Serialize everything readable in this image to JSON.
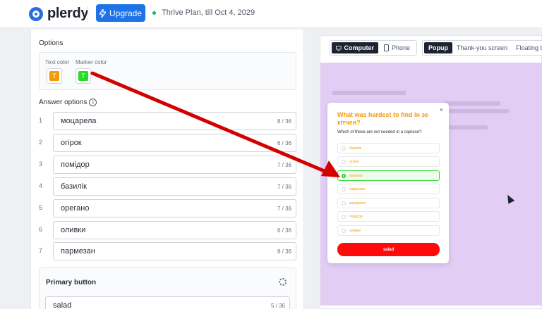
{
  "topbar": {
    "logo_text": "plerdy",
    "upgrade_label": "Upgrade",
    "plan_text": "Thrive Plan, till Oct 4, 2029"
  },
  "options": {
    "title": "Options",
    "text_color_label": "Text color",
    "marker_color_label": "Marker color",
    "text_color": "#f39a0a",
    "marker_color": "#22dd22",
    "swatch_glyph": "T"
  },
  "answers": {
    "title": "Answer options",
    "items": [
      {
        "num": "1",
        "text": "моцарела",
        "count": "8 / 36"
      },
      {
        "num": "2",
        "text": "огірок",
        "count": "6 / 36"
      },
      {
        "num": "3",
        "text": "помідор",
        "count": "7 / 36"
      },
      {
        "num": "4",
        "text": "базилік",
        "count": "7 / 36"
      },
      {
        "num": "5",
        "text": "орегано",
        "count": "7 / 36"
      },
      {
        "num": "6",
        "text": "оливки",
        "count": "6 / 36"
      },
      {
        "num": "7",
        "text": "пармезан",
        "count": "8 / 36"
      }
    ]
  },
  "primary_button": {
    "title": "Primary button",
    "value": "salad",
    "count": "5 / 36"
  },
  "preview": {
    "device_computer": "Computer",
    "device_phone": "Phone",
    "type_popup": "Popup",
    "type_thankyou": "Thank-you screen",
    "type_floating": "Floating b",
    "popup": {
      "close": "×",
      "question": "What was hardest to find ін зе кітчен?",
      "subtitle": "Which of these are not needed in a caprese?",
      "options": [
        "базилік",
        "огірок",
        "орегано",
        "пармезан",
        "моцарела",
        "помідор",
        "оливки"
      ],
      "selected_option": "орегано",
      "button_label": "salad",
      "button_color": "#ff0a0a"
    }
  },
  "annotation_color": "#d40000"
}
